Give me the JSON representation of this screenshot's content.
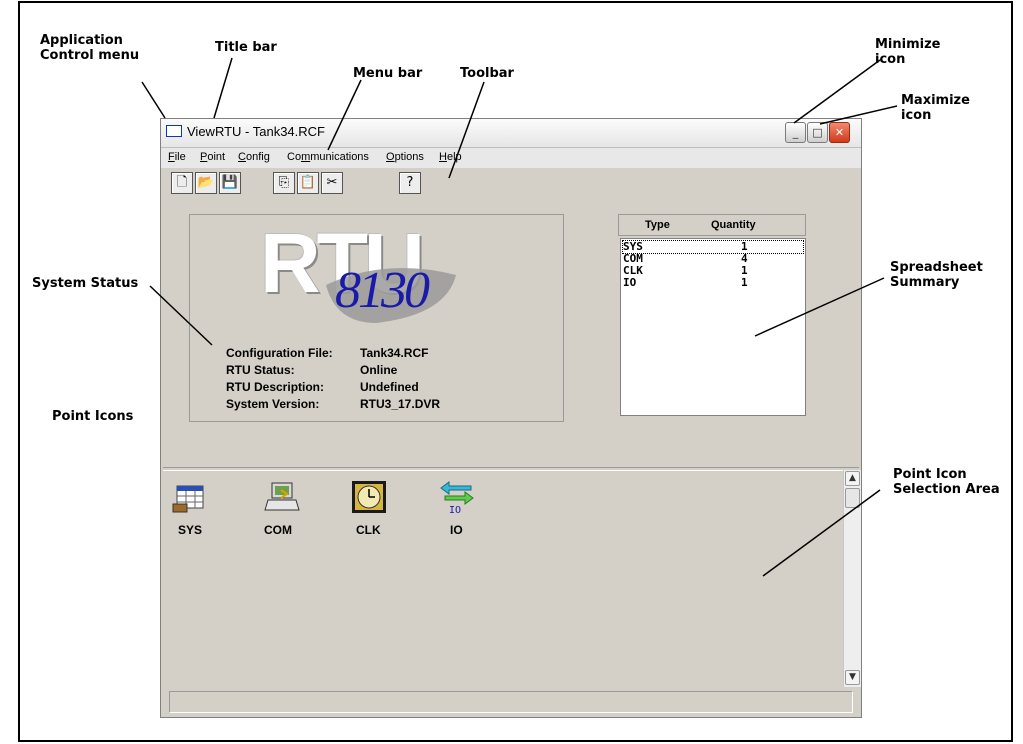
{
  "callouts": {
    "app_control_menu": "Application\nControl menu",
    "title_bar": "Title bar",
    "menu_bar": "Menu bar",
    "toolbar": "Toolbar",
    "minimize": "Minimize\nicon",
    "maximize": "Maximize\nicon",
    "system_status": "System Status",
    "spreadsheet_summary": "Spreadsheet\nSummary",
    "point_icons": "Point Icons",
    "point_icon_selection": "Point Icon\nSelection Area"
  },
  "window": {
    "title": "ViewRTU - Tank34.RCF",
    "buttons": {
      "minimize": "_",
      "maximize": "□",
      "close": "✕"
    }
  },
  "menu": [
    {
      "key": "F",
      "rest": "ile"
    },
    {
      "key": "P",
      "rest": "oint"
    },
    {
      "key": "C",
      "rest": "onfig"
    },
    {
      "pre": "Co",
      "key": "m",
      "rest": "munications"
    },
    {
      "key": "O",
      "rest": "ptions"
    },
    {
      "key": "H",
      "rest": "elp"
    }
  ],
  "toolbar": {
    "icons": [
      "new-file-icon",
      "open-folder-icon",
      "save-disk-icon",
      "copy-icon",
      "paste-icon",
      "cut-scissors-icon",
      "help-question-icon"
    ],
    "glyphs": [
      "🗋",
      "📂",
      "💾",
      "⎘",
      "📋",
      "✂",
      "?"
    ]
  },
  "logo": {
    "word": "RTU",
    "number": "8130"
  },
  "status": [
    {
      "label": "Configuration File:",
      "value": "Tank34.RCF"
    },
    {
      "label": "RTU Status:",
      "value": "Online"
    },
    {
      "label": "RTU Description:",
      "value": "Undefined"
    },
    {
      "label": "System Version:",
      "value": "RTU3_17.DVR"
    }
  ],
  "summary": {
    "headers": {
      "type": "Type",
      "quantity": "Quantity"
    },
    "rows": [
      {
        "type": "SYS",
        "quantity": "1"
      },
      {
        "type": "COM",
        "quantity": "4"
      },
      {
        "type": "CLK",
        "quantity": "1"
      },
      {
        "type": "IO",
        "quantity": "1"
      }
    ]
  },
  "point_icons": [
    {
      "label": "SYS",
      "icon": "sys-grid-icon"
    },
    {
      "label": "COM",
      "icon": "com-computer-icon"
    },
    {
      "label": "CLK",
      "icon": "clk-clock-icon"
    },
    {
      "label": "IO",
      "icon": "io-arrows-icon"
    }
  ],
  "scrollbar": {
    "up": "▲",
    "down": "▼"
  },
  "colors": {
    "accent_blue": "#1a1aa8",
    "close_red": "#d3391b",
    "window_gray": "#d4d0c8"
  }
}
